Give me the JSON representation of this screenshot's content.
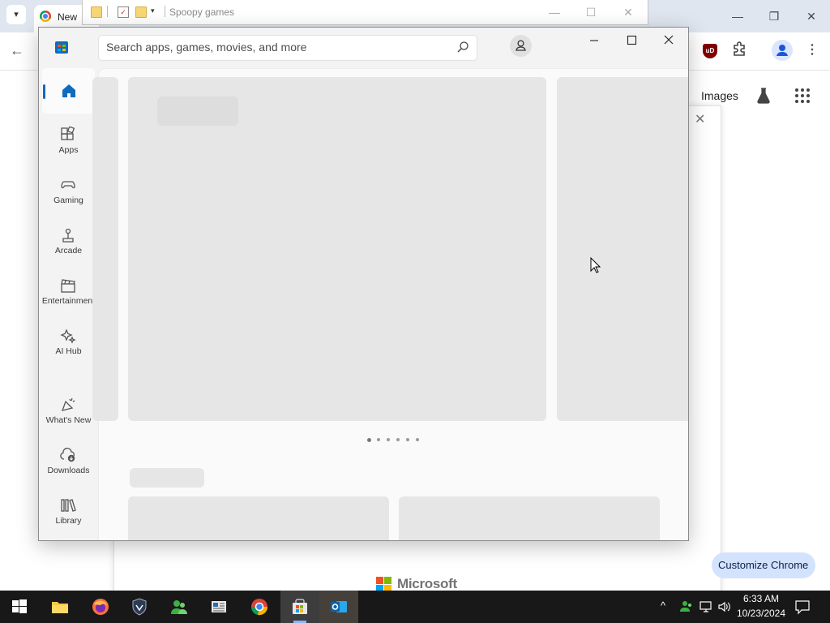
{
  "chrome": {
    "tab_title": "New",
    "images_link": "Images",
    "customize_label": "Customize Chrome",
    "footer_brand": "Microsoft",
    "icons": [
      "tab-search-icon",
      "chrome-favicon",
      "back-arrow-icon",
      "ublock-origin-icon",
      "extensions-icon",
      "profile-icon",
      "more-menu-icon",
      "labs-flask-icon",
      "apps-grid-icon",
      "close-icon"
    ]
  },
  "explorer": {
    "title": "Spoopy games"
  },
  "store": {
    "search_placeholder": "Search apps, games, movies, and more",
    "nav": [
      {
        "label": "",
        "icon": "home-icon",
        "selected": true
      },
      {
        "label": "Apps",
        "icon": "apps-icon"
      },
      {
        "label": "Gaming",
        "icon": "gaming-controller-icon"
      },
      {
        "label": "Arcade",
        "icon": "arcade-joystick-icon"
      },
      {
        "label": "Entertainment",
        "icon": "entertainment-clapper-icon"
      },
      {
        "label": "AI Hub",
        "icon": "ai-sparkle-icon"
      },
      {
        "label": "What's New",
        "icon": "whats-new-icon"
      },
      {
        "label": "Downloads",
        "icon": "downloads-icon"
      },
      {
        "label": "Library",
        "icon": "library-icon"
      }
    ],
    "carousel_page_count": 6,
    "carousel_active_page": 1,
    "accent_color": "#0f6cbd"
  },
  "taskbar": {
    "apps": [
      "start-button",
      "file-explorer",
      "firefox",
      "security-shield-app",
      "people-green-app",
      "news-app",
      "chrome",
      "microsoft-store",
      "outlook"
    ],
    "time": "6:33 AM",
    "date": "10/23/2024"
  }
}
